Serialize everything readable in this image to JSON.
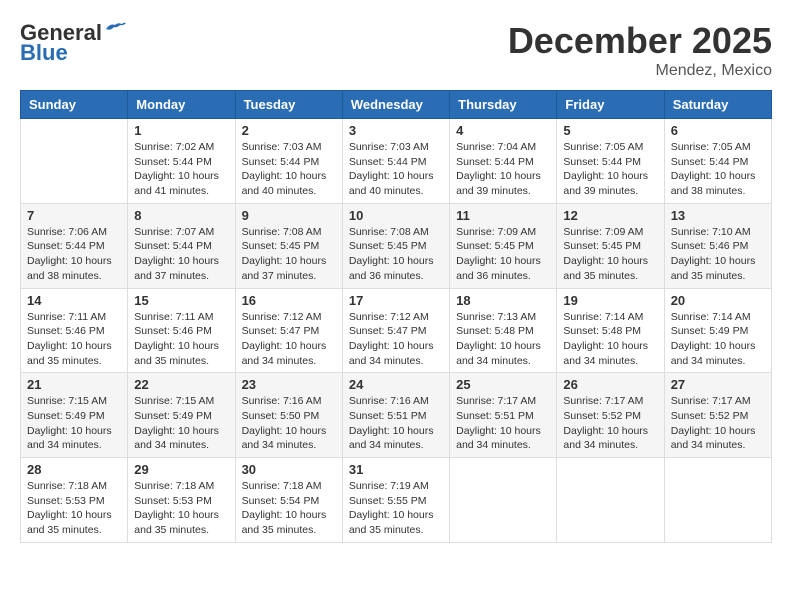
{
  "header": {
    "logo_general": "General",
    "logo_blue": "Blue",
    "month_year": "December 2025",
    "location": "Mendez, Mexico"
  },
  "days_of_week": [
    "Sunday",
    "Monday",
    "Tuesday",
    "Wednesday",
    "Thursday",
    "Friday",
    "Saturday"
  ],
  "weeks": [
    [
      {
        "date": "",
        "info": ""
      },
      {
        "date": "1",
        "info": "Sunrise: 7:02 AM\nSunset: 5:44 PM\nDaylight: 10 hours\nand 41 minutes."
      },
      {
        "date": "2",
        "info": "Sunrise: 7:03 AM\nSunset: 5:44 PM\nDaylight: 10 hours\nand 40 minutes."
      },
      {
        "date": "3",
        "info": "Sunrise: 7:03 AM\nSunset: 5:44 PM\nDaylight: 10 hours\nand 40 minutes."
      },
      {
        "date": "4",
        "info": "Sunrise: 7:04 AM\nSunset: 5:44 PM\nDaylight: 10 hours\nand 39 minutes."
      },
      {
        "date": "5",
        "info": "Sunrise: 7:05 AM\nSunset: 5:44 PM\nDaylight: 10 hours\nand 39 minutes."
      },
      {
        "date": "6",
        "info": "Sunrise: 7:05 AM\nSunset: 5:44 PM\nDaylight: 10 hours\nand 38 minutes."
      }
    ],
    [
      {
        "date": "7",
        "info": "Sunrise: 7:06 AM\nSunset: 5:44 PM\nDaylight: 10 hours\nand 38 minutes."
      },
      {
        "date": "8",
        "info": "Sunrise: 7:07 AM\nSunset: 5:44 PM\nDaylight: 10 hours\nand 37 minutes."
      },
      {
        "date": "9",
        "info": "Sunrise: 7:08 AM\nSunset: 5:45 PM\nDaylight: 10 hours\nand 37 minutes."
      },
      {
        "date": "10",
        "info": "Sunrise: 7:08 AM\nSunset: 5:45 PM\nDaylight: 10 hours\nand 36 minutes."
      },
      {
        "date": "11",
        "info": "Sunrise: 7:09 AM\nSunset: 5:45 PM\nDaylight: 10 hours\nand 36 minutes."
      },
      {
        "date": "12",
        "info": "Sunrise: 7:09 AM\nSunset: 5:45 PM\nDaylight: 10 hours\nand 35 minutes."
      },
      {
        "date": "13",
        "info": "Sunrise: 7:10 AM\nSunset: 5:46 PM\nDaylight: 10 hours\nand 35 minutes."
      }
    ],
    [
      {
        "date": "14",
        "info": "Sunrise: 7:11 AM\nSunset: 5:46 PM\nDaylight: 10 hours\nand 35 minutes."
      },
      {
        "date": "15",
        "info": "Sunrise: 7:11 AM\nSunset: 5:46 PM\nDaylight: 10 hours\nand 35 minutes."
      },
      {
        "date": "16",
        "info": "Sunrise: 7:12 AM\nSunset: 5:47 PM\nDaylight: 10 hours\nand 34 minutes."
      },
      {
        "date": "17",
        "info": "Sunrise: 7:12 AM\nSunset: 5:47 PM\nDaylight: 10 hours\nand 34 minutes."
      },
      {
        "date": "18",
        "info": "Sunrise: 7:13 AM\nSunset: 5:48 PM\nDaylight: 10 hours\nand 34 minutes."
      },
      {
        "date": "19",
        "info": "Sunrise: 7:14 AM\nSunset: 5:48 PM\nDaylight: 10 hours\nand 34 minutes."
      },
      {
        "date": "20",
        "info": "Sunrise: 7:14 AM\nSunset: 5:49 PM\nDaylight: 10 hours\nand 34 minutes."
      }
    ],
    [
      {
        "date": "21",
        "info": "Sunrise: 7:15 AM\nSunset: 5:49 PM\nDaylight: 10 hours\nand 34 minutes."
      },
      {
        "date": "22",
        "info": "Sunrise: 7:15 AM\nSunset: 5:49 PM\nDaylight: 10 hours\nand 34 minutes."
      },
      {
        "date": "23",
        "info": "Sunrise: 7:16 AM\nSunset: 5:50 PM\nDaylight: 10 hours\nand 34 minutes."
      },
      {
        "date": "24",
        "info": "Sunrise: 7:16 AM\nSunset: 5:51 PM\nDaylight: 10 hours\nand 34 minutes."
      },
      {
        "date": "25",
        "info": "Sunrise: 7:17 AM\nSunset: 5:51 PM\nDaylight: 10 hours\nand 34 minutes."
      },
      {
        "date": "26",
        "info": "Sunrise: 7:17 AM\nSunset: 5:52 PM\nDaylight: 10 hours\nand 34 minutes."
      },
      {
        "date": "27",
        "info": "Sunrise: 7:17 AM\nSunset: 5:52 PM\nDaylight: 10 hours\nand 34 minutes."
      }
    ],
    [
      {
        "date": "28",
        "info": "Sunrise: 7:18 AM\nSunset: 5:53 PM\nDaylight: 10 hours\nand 35 minutes."
      },
      {
        "date": "29",
        "info": "Sunrise: 7:18 AM\nSunset: 5:53 PM\nDaylight: 10 hours\nand 35 minutes."
      },
      {
        "date": "30",
        "info": "Sunrise: 7:18 AM\nSunset: 5:54 PM\nDaylight: 10 hours\nand 35 minutes."
      },
      {
        "date": "31",
        "info": "Sunrise: 7:19 AM\nSunset: 5:55 PM\nDaylight: 10 hours\nand 35 minutes."
      },
      {
        "date": "",
        "info": ""
      },
      {
        "date": "",
        "info": ""
      },
      {
        "date": "",
        "info": ""
      }
    ]
  ]
}
